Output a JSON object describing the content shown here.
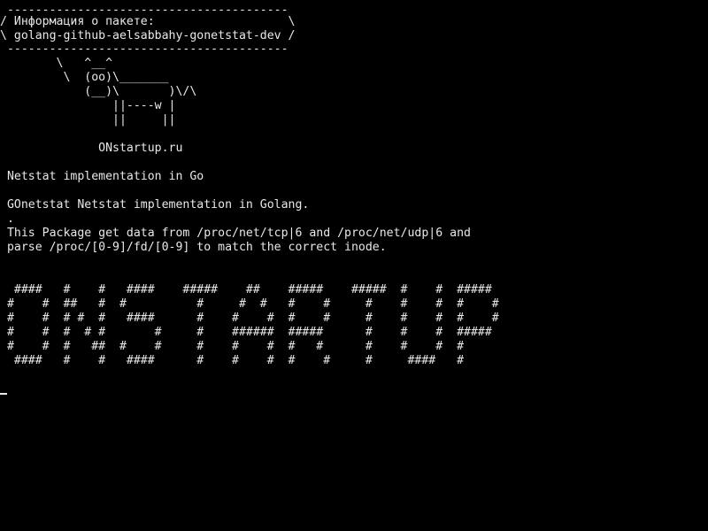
{
  "colors": {
    "background": "#000000",
    "foreground": "#e8e8e8"
  },
  "terminal": {
    "lines": [
      " ----------------------------------------",
      "/ Информация о пакете:                   \\",
      "\\ golang-github-aelsabbahy-gonetstat-dev /",
      " ----------------------------------------",
      "        \\   ^__^",
      "         \\  (oo)\\_______",
      "            (__)\\       )\\/\\",
      "                ||----w |",
      "                ||     ||",
      "",
      "              ONstartup.ru",
      "",
      " Netstat implementation in Go",
      "",
      " GOnetstat Netstat implementation in Golang.",
      " .",
      " This Package get data from /proc/net/tcp|6 and /proc/net/udp|6 and",
      " parse /proc/[0-9]/fd/[0-9] to match the correct inode.",
      "",
      "",
      "  ####   #    #   ####    #####    ##    #####    #####  #    #  #####",
      " #    #  ##   #  #          #     #  #   #    #     #    #    #  #    #",
      " #    #  # #  #   ####      #    #    #  #    #     #    #    #  #    #",
      " #    #  #  # #       #     #    ######  #####      #    #    #  #####",
      " #    #  #   ##  #    #     #    #    #  #   #      #    #    #  #",
      "  ####   #    #   ####      #    #    #  #    #     #     ####   #"
    ]
  }
}
